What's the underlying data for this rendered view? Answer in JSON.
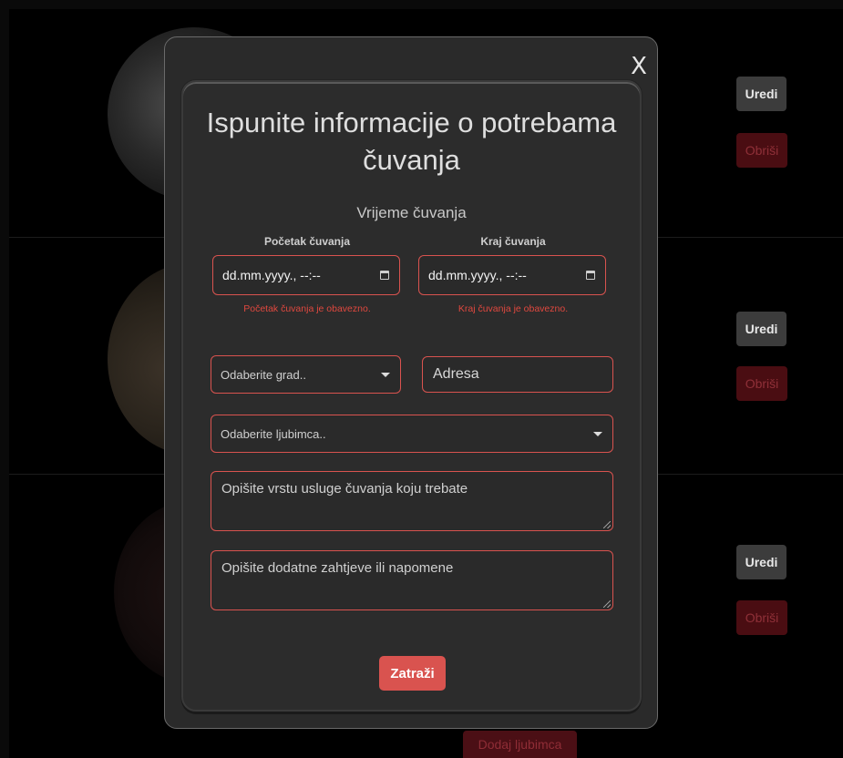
{
  "background": {
    "pets": [
      {
        "edit_label": "Uredi",
        "delete_label": "Obriši"
      },
      {
        "edit_label": "Uredi",
        "delete_label": "Obriši"
      },
      {
        "edit_label": "Uredi",
        "delete_label": "Obriši"
      }
    ],
    "add_pet_label": "Dodaj ljubimca"
  },
  "modal": {
    "close_symbol": "X",
    "title": "Ispunite informacije o potrebama čuvanja",
    "section_title": "Vrijeme čuvanja",
    "start": {
      "label": "Početak čuvanja",
      "value": "dd.mm.yyyy., --:--",
      "error": "Početak čuvanja je obavezno."
    },
    "end": {
      "label": "Kraj čuvanja",
      "value": "dd.mm.yyyy., --:--",
      "error": "Kraj čuvanja je obavezno."
    },
    "city_select": {
      "selected": "Odaberite grad.."
    },
    "address": {
      "placeholder": "Adresa"
    },
    "pet_select": {
      "selected": "Odaberite ljubimca.."
    },
    "service_description": {
      "placeholder": "Opišite vrstu usluge čuvanja koju trebate"
    },
    "additional_notes": {
      "placeholder": "Opišite dodatne zahtjeve ili napomene"
    },
    "submit_label": "Zatraži"
  },
  "colors": {
    "accent": "#d9534f",
    "error": "#e0483f",
    "modal_bg": "#2c2c2c"
  },
  "icons": [
    "close-icon",
    "calendar-icon",
    "chevron-down-icon"
  ]
}
